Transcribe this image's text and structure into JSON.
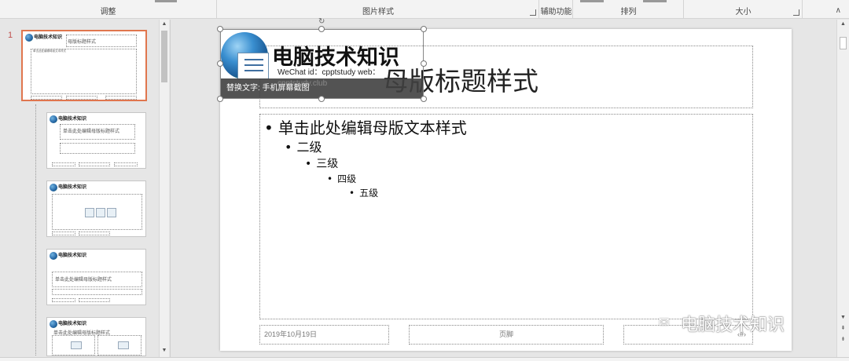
{
  "ribbon": {
    "groups": [
      {
        "label": "调整"
      },
      {
        "label": "图片样式"
      },
      {
        "label": "辅助功能"
      },
      {
        "label": "排列"
      },
      {
        "label": "大小"
      }
    ]
  },
  "thumbnails": {
    "selected_number": "1",
    "items": [
      {
        "title": "电脑技术知识",
        "subtitle": "母版标题样式",
        "body": "单击此处编辑母版文本样式"
      },
      {
        "title": "电脑技术知识",
        "subtitle": "单击此处编辑母版标题样式"
      },
      {
        "title": "电脑技术知识",
        "subtitle": "单击此处编辑母版标题样式"
      },
      {
        "title": "电脑技术知识",
        "subtitle": "单击此处编辑母版标题样式"
      },
      {
        "title": "电脑技术知识",
        "subtitle": "单击此处编辑母版标题样式"
      }
    ]
  },
  "slide": {
    "title": "母版标题样式",
    "bullets": [
      {
        "text": "单击此处编辑母版文本样式"
      },
      {
        "text": "二级"
      },
      {
        "text": "三级"
      },
      {
        "text": "四级"
      },
      {
        "text": "五级"
      }
    ],
    "footer_date": "2019年10月19日",
    "footer_center": "页脚",
    "footer_page": "‹#›"
  },
  "picture": {
    "title": "电脑技术知识",
    "subtitle": "WeChat id：cpptstudy web：",
    "subtitle2": "cpptstudy.club",
    "alt_text": "替换文字: 手机屏幕截图"
  },
  "watermark": "电脑技术知识",
  "colors": {
    "selection_border": "#e0764e",
    "slide_number": "#c0504d"
  }
}
